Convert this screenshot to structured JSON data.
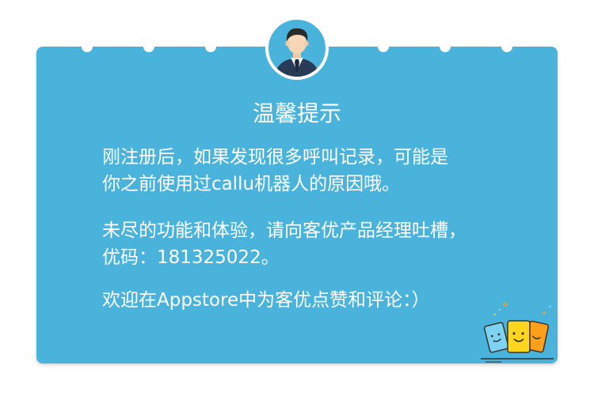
{
  "notice": {
    "title": "温馨提示",
    "paragraph1": {
      "line1": "刚注册后，如果发现很多呼叫记录，可能是",
      "line2": "你之前使用过callu机器人的原因哦。"
    },
    "paragraph2": {
      "line1": "未尽的功能和体验，请向客优产品经理吐槽，",
      "line2": "优码：181325022。"
    },
    "paragraph3": {
      "line1": "欢迎在Appstore中为客优点赞和评论：）"
    }
  },
  "icons": {
    "avatar": "businessman-avatar-icon",
    "decoration": "smiling-cards-icon"
  },
  "colors": {
    "card_background": "#4ab3dc",
    "text": "#ffffff",
    "suit": "#2b3a55",
    "card_yellow": "#ffd61e",
    "card_orange": "#ff9f1c",
    "card_blue": "#7fd3f2"
  }
}
